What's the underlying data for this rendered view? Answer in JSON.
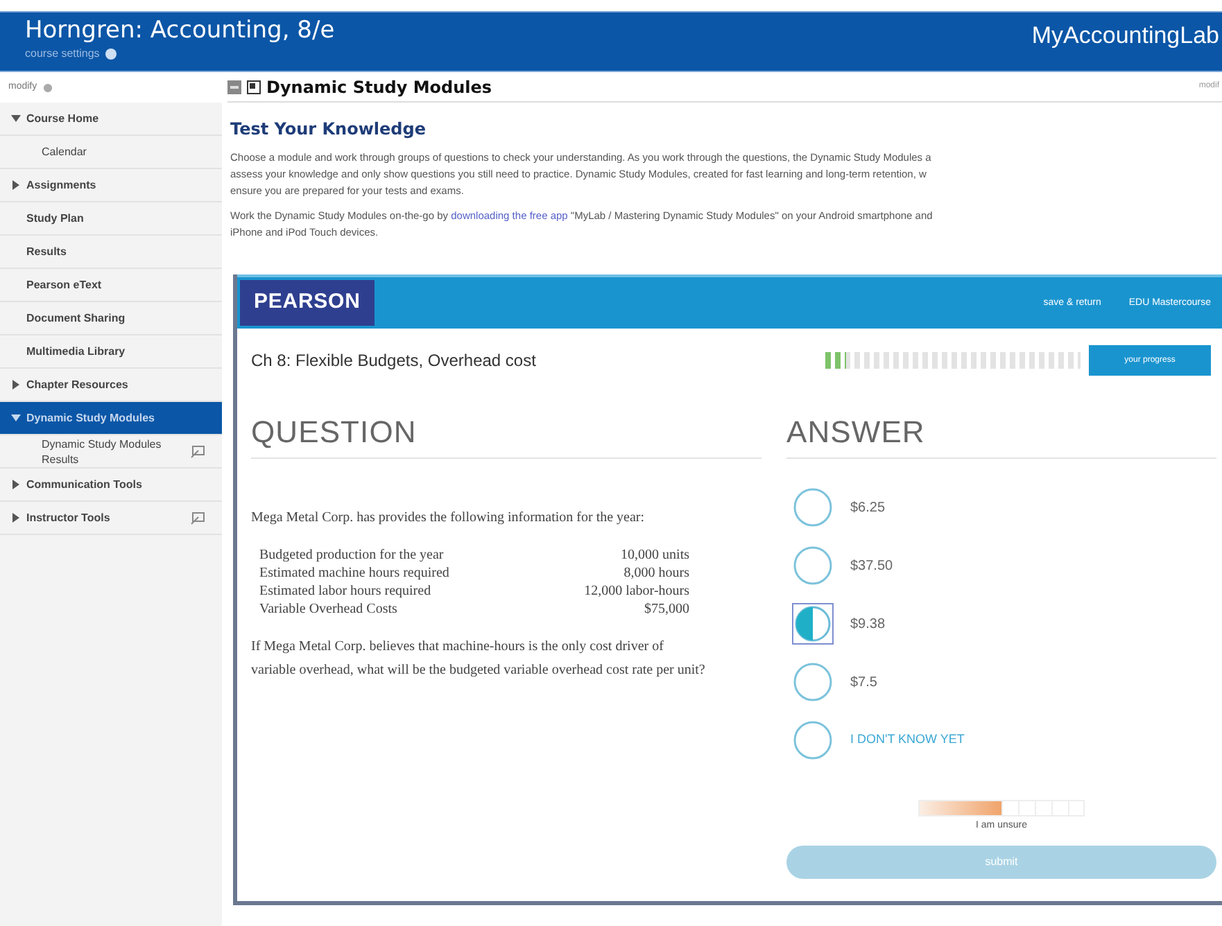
{
  "header": {
    "title": "Horngren: Accounting, 8/e",
    "subtitle": "course settings",
    "brand": "MyAccountingLab"
  },
  "sidebar": {
    "top_link": "modify",
    "items": [
      {
        "label": "Course Home",
        "expandable": true,
        "expanded": true,
        "selected": false,
        "popout_icon": false,
        "children": [
          {
            "label": "Calendar",
            "selected": false,
            "popout_icon": false
          }
        ]
      },
      {
        "label": "Assignments",
        "expandable": true,
        "expanded": false,
        "selected": false,
        "popout_icon": false
      },
      {
        "label": "Study Plan",
        "expandable": false,
        "selected": false,
        "popout_icon": false
      },
      {
        "label": "Results",
        "expandable": false,
        "selected": false,
        "popout_icon": false
      },
      {
        "label": "Pearson eText",
        "expandable": false,
        "selected": false,
        "popout_icon": false
      },
      {
        "label": "Document Sharing",
        "expandable": false,
        "selected": false,
        "popout_icon": false
      },
      {
        "label": "Multimedia Library",
        "expandable": false,
        "selected": false,
        "popout_icon": false
      },
      {
        "label": "Chapter Resources",
        "expandable": true,
        "expanded": false,
        "selected": false,
        "popout_icon": false
      },
      {
        "label": "Dynamic Study Modules",
        "expandable": true,
        "expanded": true,
        "selected": true,
        "popout_icon": false,
        "children": [
          {
            "label": "Dynamic Study Modules Results",
            "selected": false,
            "popout_icon": true
          }
        ]
      },
      {
        "label": "Communication Tools",
        "expandable": true,
        "expanded": false,
        "selected": false,
        "popout_icon": false
      },
      {
        "label": "Instructor Tools",
        "expandable": true,
        "expanded": false,
        "selected": false,
        "popout_icon": true
      }
    ]
  },
  "page": {
    "title": "Dynamic Study Modules",
    "corner_link": "modif",
    "heading": "Test Your Knowledge",
    "intro_lines": [
      "Choose a module and work through groups of questions to check your understanding. As you work through the questions, the Dynamic Study Modules a",
      "assess your knowledge and only show questions you still need to practice. Dynamic Study Modules, created for fast learning and long-term retention, w",
      "ensure you are prepared for your tests and exams."
    ],
    "app_line": {
      "before": "Work the Dynamic Study Modules on-the-go by ",
      "link": "downloading the free app",
      "after": " \"MyLab / Mastering Dynamic Study Modules\" on your Android smartphone and"
    },
    "app_line_2": "iPhone and iPod Touch devices."
  },
  "module": {
    "brand": "PEARSON",
    "nav_links": [
      "save & return",
      "EDU Mastercourse"
    ],
    "chapter": "Ch 8: Flexible Budgets, Overhead cost",
    "progress": {
      "level": 0.08,
      "button": "your progress"
    },
    "question_heading": "QUESTION",
    "answer_heading": "ANSWER",
    "question_intro": "Mega Metal Corp. has provides the following information for the year:",
    "facts": [
      {
        "label": "Budgeted production for the year",
        "value": "10,000 units"
      },
      {
        "label": "Estimated machine hours required",
        "value": "8,000 hours"
      },
      {
        "label": "Estimated labor hours required",
        "value": "12,000 labor-hours"
      },
      {
        "label": "Variable Overhead Costs",
        "value": "$75,000"
      }
    ],
    "question": "If Mega Metal Corp. believes that machine-hours is the only cost driver of variable overhead, what will be the budgeted variable overhead cost rate per unit?",
    "answers": [
      {
        "kind": "option",
        "label": "$6.25",
        "selected": false
      },
      {
        "kind": "option",
        "label": "$37.50",
        "selected": false
      },
      {
        "kind": "option",
        "label": "$9.38",
        "selected": true
      },
      {
        "kind": "option",
        "label": "$7.5",
        "selected": false
      },
      {
        "kind": "unknown",
        "label": "I DON'T KNOW YET",
        "selected": false
      }
    ],
    "confidence": {
      "level": 0.5,
      "label": "I am unsure"
    },
    "submit": {
      "label": "submit",
      "disabled": true
    }
  }
}
